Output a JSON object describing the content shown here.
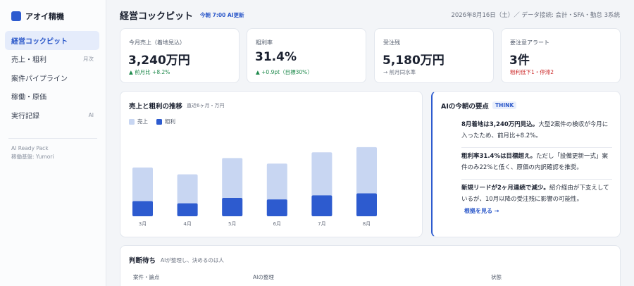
{
  "brand": {
    "name": "アオイ精機"
  },
  "nav": [
    {
      "label": "経営コックピット",
      "badge": ""
    },
    {
      "label": "売上・粗利",
      "badge": "月次"
    },
    {
      "label": "案件パイプライン",
      "badge": ""
    },
    {
      "label": "稼働・原価",
      "badge": ""
    },
    {
      "label": "実行記録",
      "badge": "AI"
    }
  ],
  "sidebar_footer": {
    "line1": "AI Ready Pack",
    "line2": "稼働基盤: Yumori"
  },
  "header": {
    "title": "経営コックピット",
    "badge": "今朝 7:00 AI更新",
    "meta": "2026年8月16日（土）／ データ接続: 会計・SFA・勤怠 3系統"
  },
  "kpis": [
    {
      "label": "今月売上（着地見込）",
      "value": "3,240万円",
      "sub": "▲ 前月比 +8.2%",
      "tone": "up"
    },
    {
      "label": "粗利率",
      "value": "31.4%",
      "sub": "▲ +0.9pt（目標30%）",
      "tone": "up"
    },
    {
      "label": "受注残",
      "value": "5,180万円",
      "sub": "→ 前月同水準",
      "tone": "neutral"
    },
    {
      "label": "要注意アラート",
      "value": "3件",
      "sub": "粗利低下1・停滞2",
      "tone": "alert"
    }
  ],
  "chart": {
    "title": "売上と粗利の推移",
    "subtitle": "直近6ヶ月・万円",
    "legend_sales": "売上",
    "legend_profit": "粗利"
  },
  "chart_data": {
    "type": "bar",
    "categories": [
      "3月",
      "4月",
      "5月",
      "6月",
      "7月",
      "8月"
    ],
    "series": [
      {
        "name": "売上",
        "values": [
          2640,
          2270,
          3150,
          2850,
          3460,
          3740
        ]
      },
      {
        "name": "粗利",
        "values": [
          820,
          700,
          990,
          910,
          1130,
          1240
        ]
      }
    ],
    "ylim": [
      0,
      4500
    ],
    "colors": {
      "売上": "#c8d6f2",
      "粗利": "#2d5bcf"
    },
    "grid": false
  },
  "ai": {
    "title": "AIの今朝の要点",
    "tag": "THINK",
    "p1_bold": "8月着地は3,240万円見込。",
    "p1_rest": "大型2案件の検収が今月に入ったため、前月比+8.2%。",
    "p2_bold": "粗利率31.4%は目標超え。",
    "p2_rest": "ただし「設備更新一式」案件のみ22%と低く、原価の内訳確認を推奨。",
    "p3_bold": "新規リードが2ヶ月連続で減少。",
    "p3_rest": "紹介経由が下支えしているが、10月以降の受注残に影響の可能性。",
    "link": "根拠を見る →"
  },
  "decisions": {
    "title": "判断待ち",
    "subtitle": "AIが整理し、決めるのは人",
    "columns": [
      "案件・論点",
      "AIの整理",
      "状態"
    ]
  }
}
